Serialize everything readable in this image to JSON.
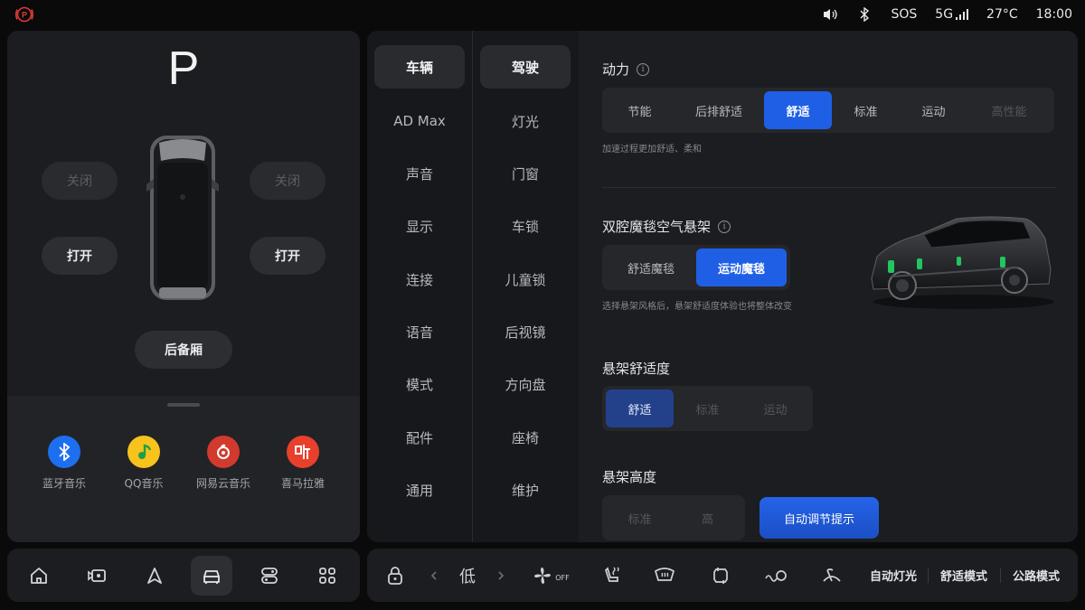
{
  "status_bar": {
    "park_brake_icon": "parking-brake-warning-icon",
    "sos": "SOS",
    "network": "5G",
    "temperature": "27°C",
    "time": "18:00"
  },
  "vehicle": {
    "gear": "P",
    "left_front_door": "关闭",
    "right_front_door": "关闭",
    "left_rear_door": "打开",
    "right_rear_door": "打开",
    "trunk": "后备厢"
  },
  "media_apps": [
    {
      "label": "蓝牙音乐",
      "icon": "bluetooth-music-icon",
      "color": "#1e6ff0"
    },
    {
      "label": "QQ音乐",
      "icon": "qq-music-icon",
      "color": "#f7c31c"
    },
    {
      "label": "网易云音乐",
      "icon": "netease-music-icon",
      "color": "#d23a2e"
    },
    {
      "label": "喜马拉雅",
      "icon": "ximalaya-icon",
      "color": "#e8402c"
    }
  ],
  "left_dock": [
    "home-icon",
    "camera-icon",
    "navigation-icon",
    "car-icon",
    "control-icon",
    "apps-icon"
  ],
  "nav_primary": [
    "车辆",
    "AD Max",
    "声音",
    "显示",
    "连接",
    "语音",
    "模式",
    "配件",
    "通用"
  ],
  "nav_secondary": [
    "驾驶",
    "灯光",
    "门窗",
    "车锁",
    "儿童锁",
    "后视镜",
    "方向盘",
    "座椅",
    "维护"
  ],
  "power": {
    "title": "动力",
    "options": [
      "节能",
      "后排舒适",
      "舒适",
      "标准",
      "运动",
      "高性能"
    ],
    "selected": "舒适",
    "hint": "加速过程更加舒适、柔和"
  },
  "air_suspension": {
    "title": "双腔魔毯空气悬架",
    "options": [
      "舒适魔毯",
      "运动魔毯"
    ],
    "selected": "运动魔毯",
    "hint": "选择悬架风格后，悬架舒适度体验也将整体改变"
  },
  "suspension_comfort": {
    "title": "悬架舒适度",
    "options": [
      "舒适",
      "标准",
      "运动"
    ],
    "selected": "舒适"
  },
  "suspension_height": {
    "title": "悬架高度",
    "options": [
      "标准",
      "高"
    ],
    "auto_adjust_button": "自动调节提示"
  },
  "right_dock": {
    "fan_level": "低",
    "fan_state": "OFF",
    "auto_lights": "自动灯光",
    "comfort_mode": "舒适模式",
    "road_mode": "公路模式"
  },
  "colors": {
    "accent": "#1f5fe6",
    "panel": "#1c1d20",
    "background": "#0a0a0b",
    "suspension_highlight": "#22c55e"
  }
}
